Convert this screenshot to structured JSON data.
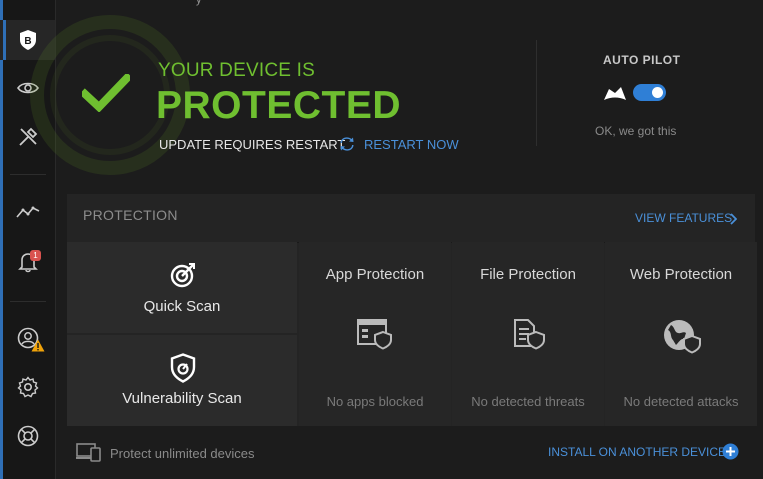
{
  "window": {
    "top_partial_text": "y"
  },
  "sidebar": {
    "items": [
      {
        "icon": "bitdefender-logo-icon"
      },
      {
        "icon": "eye-icon"
      },
      {
        "icon": "tools-icon"
      },
      {
        "icon": "activity-graph-icon"
      },
      {
        "icon": "bell-icon",
        "badge": "1"
      },
      {
        "icon": "account-icon",
        "warning": true
      },
      {
        "icon": "gear-icon"
      },
      {
        "icon": "lifebuoy-icon"
      }
    ]
  },
  "hero": {
    "status_line": "YOUR DEVICE IS",
    "status_big": "PROTECTED",
    "update_text": "UPDATE REQUIRES RESTART",
    "restart_label": "RESTART NOW",
    "accent_color": "#6fbf30"
  },
  "autopilot": {
    "title": "AUTO PILOT",
    "enabled": true,
    "status": "OK, we got this"
  },
  "protection": {
    "title": "PROTECTION",
    "view_features": "VIEW FEATURES",
    "scans": [
      {
        "label": "Quick Scan",
        "icon": "target-scan-icon"
      },
      {
        "label": "Vulnerability Scan",
        "icon": "shield-scan-icon"
      }
    ],
    "features": [
      {
        "title": "App Protection",
        "status": "No apps blocked",
        "icon": "app-shield-icon"
      },
      {
        "title": "File Protection",
        "status": "No detected threats",
        "icon": "file-shield-icon"
      },
      {
        "title": "Web Protection",
        "status": "No detected attacks",
        "icon": "globe-shield-icon"
      }
    ]
  },
  "footer": {
    "left_text": "Protect unlimited devices",
    "right_link": "INSTALL ON ANOTHER DEVICE"
  },
  "colors": {
    "link": "#4a90d9",
    "green": "#6fbf30",
    "background": "#1c1c1c",
    "panel": "#242424"
  }
}
